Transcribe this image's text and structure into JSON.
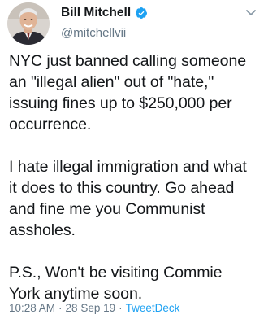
{
  "author": {
    "display_name": "Bill Mitchell",
    "handle": "@mitchellvii",
    "verified": true,
    "verified_color": "#1da1f2"
  },
  "tweet": {
    "paragraphs": [
      "NYC just banned calling someone\nan \"illegal alien\" out of \"hate,\"\nissuing fines up to $250,000 per\noccurrence.",
      "I hate illegal immigration and what\nit does to this country.  Go ahead\nand fine me you Communist\nassholes.",
      "P.S., Won't be visiting Commie\nYork anytime soon."
    ]
  },
  "meta": {
    "time": "10:28 AM",
    "date": "28 Sep 19",
    "separator": "·",
    "source": "TweetDeck",
    "source_color": "#1da1f2"
  },
  "icons": {
    "verified": "verified-badge-icon",
    "menu": "chevron-down-icon"
  }
}
